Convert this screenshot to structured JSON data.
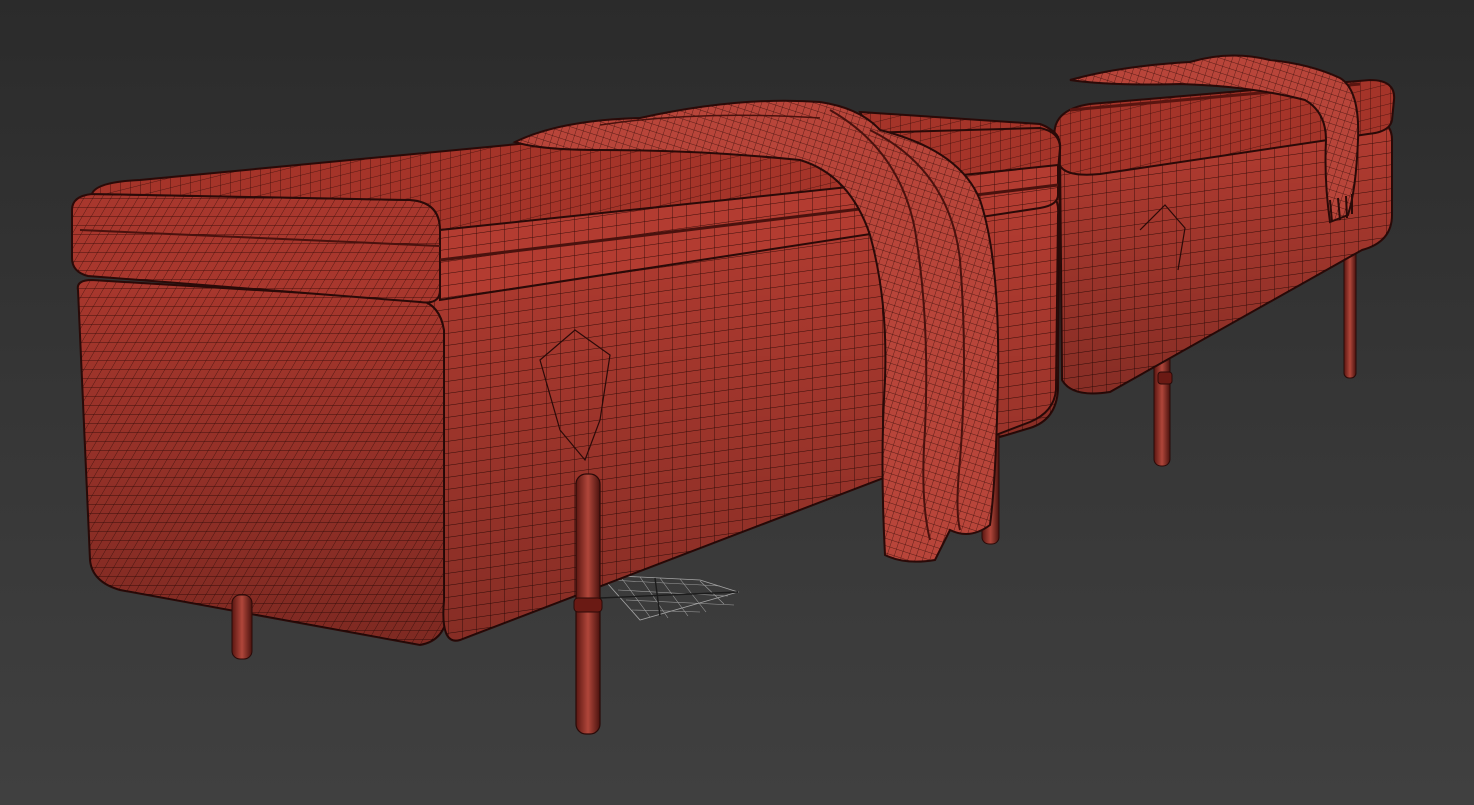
{
  "scene": {
    "description_colors": {
      "background_top": "#2b2b2b",
      "background_bottom": "#404040",
      "surface": "#b43a30",
      "surface_dark": "#7a1e18",
      "wire": "#2a0a08",
      "leg": "#8a2a22"
    },
    "objects": [
      "bench-left",
      "bench-right",
      "throw-blanket",
      "legs",
      "ground-grid-gizmo"
    ]
  }
}
